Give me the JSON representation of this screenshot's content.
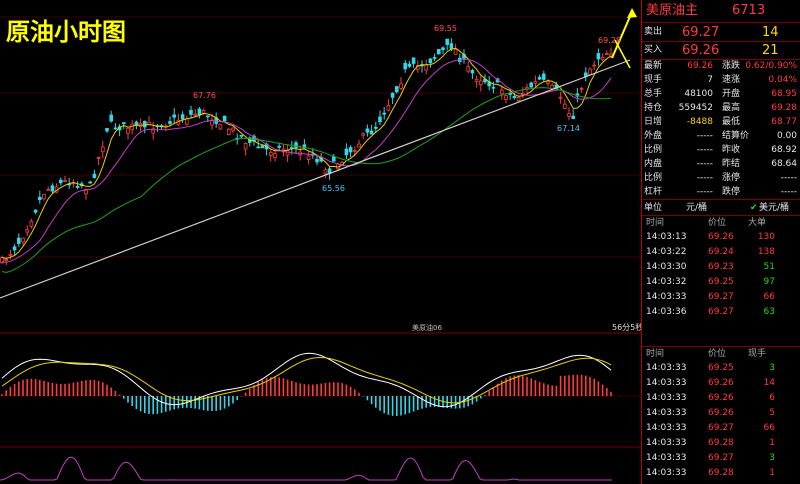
{
  "overlay": {
    "title": "原油小时图"
  },
  "chart": {
    "price_labels": {
      "high1": "67.76",
      "high2": "69.55",
      "low1": "65.56",
      "low2": "67.14",
      "last": "69.28"
    },
    "indicator_label": "美原油06",
    "timer": "56分5秒"
  },
  "panel": {
    "title": "美原油主",
    "code": "6713",
    "sell": {
      "label": "卖出",
      "price": "69.27",
      "qty": "14"
    },
    "buy": {
      "label": "买入",
      "price": "69.26",
      "qty": "21"
    },
    "stats": [
      {
        "l1": "最新",
        "v1": "69.26",
        "c1": "red",
        "l2": "涨跌",
        "v2": "0.62/0.90%",
        "c2": "red"
      },
      {
        "l1": "现手",
        "v1": "7",
        "c1": "white",
        "l2": "速涨",
        "v2": "0.04%",
        "c2": "red"
      },
      {
        "l1": "总手",
        "v1": "48100",
        "c1": "white",
        "l2": "开盘",
        "v2": "68.95",
        "c2": "red"
      },
      {
        "l1": "持仓",
        "v1": "559452",
        "c1": "white",
        "l2": "最高",
        "v2": "69.28",
        "c2": "red"
      },
      {
        "l1": "日增",
        "v1": "-8488",
        "c1": "yellow",
        "l2": "最低",
        "v2": "68.77",
        "c2": "red"
      },
      {
        "l1": "外盘",
        "v1": "-----",
        "c1": "white",
        "l2": "结算价",
        "v2": "0.00",
        "c2": "white"
      },
      {
        "l1": "比例",
        "v1": "-----",
        "c1": "white",
        "l2": "昨收",
        "v2": "68.92",
        "c2": "white"
      },
      {
        "l1": "内盘",
        "v1": "-----",
        "c1": "white",
        "l2": "昨结",
        "v2": "68.64",
        "c2": "white"
      },
      {
        "l1": "比例",
        "v1": "-----",
        "c1": "white",
        "l2": "涨停",
        "v2": "-----",
        "c2": "white"
      },
      {
        "l1": "杠杆",
        "v1": "-----",
        "c1": "white",
        "l2": "跌停",
        "v2": "-----",
        "c2": "white"
      }
    ],
    "unit": {
      "label": "单位",
      "value": "元/桶",
      "option": "美元/桶"
    },
    "trades1_header": {
      "time": "时间",
      "price": "价位",
      "vol": "大单"
    },
    "trades1": [
      {
        "time": "14:03:13",
        "price": "69.26",
        "vol": "130"
      },
      {
        "time": "14:03:22",
        "price": "69.24",
        "vol": "138"
      },
      {
        "time": "14:03:30",
        "price": "69.23",
        "vol": "51"
      },
      {
        "time": "14:03:32",
        "price": "69.25",
        "vol": "97"
      },
      {
        "time": "14:03:33",
        "price": "69.27",
        "vol": "66"
      },
      {
        "time": "14:03:36",
        "price": "69.27",
        "vol": "63"
      }
    ],
    "trades2_header": {
      "time": "时间",
      "price": "价位",
      "vol": "现手"
    },
    "trades2": [
      {
        "time": "14:03:33",
        "price": "69.25",
        "vol": "3"
      },
      {
        "time": "14:03:33",
        "price": "69.26",
        "vol": "14"
      },
      {
        "time": "14:03:33",
        "price": "69.26",
        "vol": "6"
      },
      {
        "time": "14:03:33",
        "price": "69.26",
        "vol": "5"
      },
      {
        "time": "14:03:33",
        "price": "69.27",
        "vol": "66"
      },
      {
        "time": "14:03:33",
        "price": "69.28",
        "vol": "1"
      },
      {
        "time": "14:03:33",
        "price": "69.27",
        "vol": "3"
      },
      {
        "time": "14:03:33",
        "price": "69.28",
        "vol": "1"
      }
    ],
    "colors": {
      "up": "#ff3b3b",
      "down": "#1fdc1f",
      "accent": "#ffd400"
    }
  }
}
